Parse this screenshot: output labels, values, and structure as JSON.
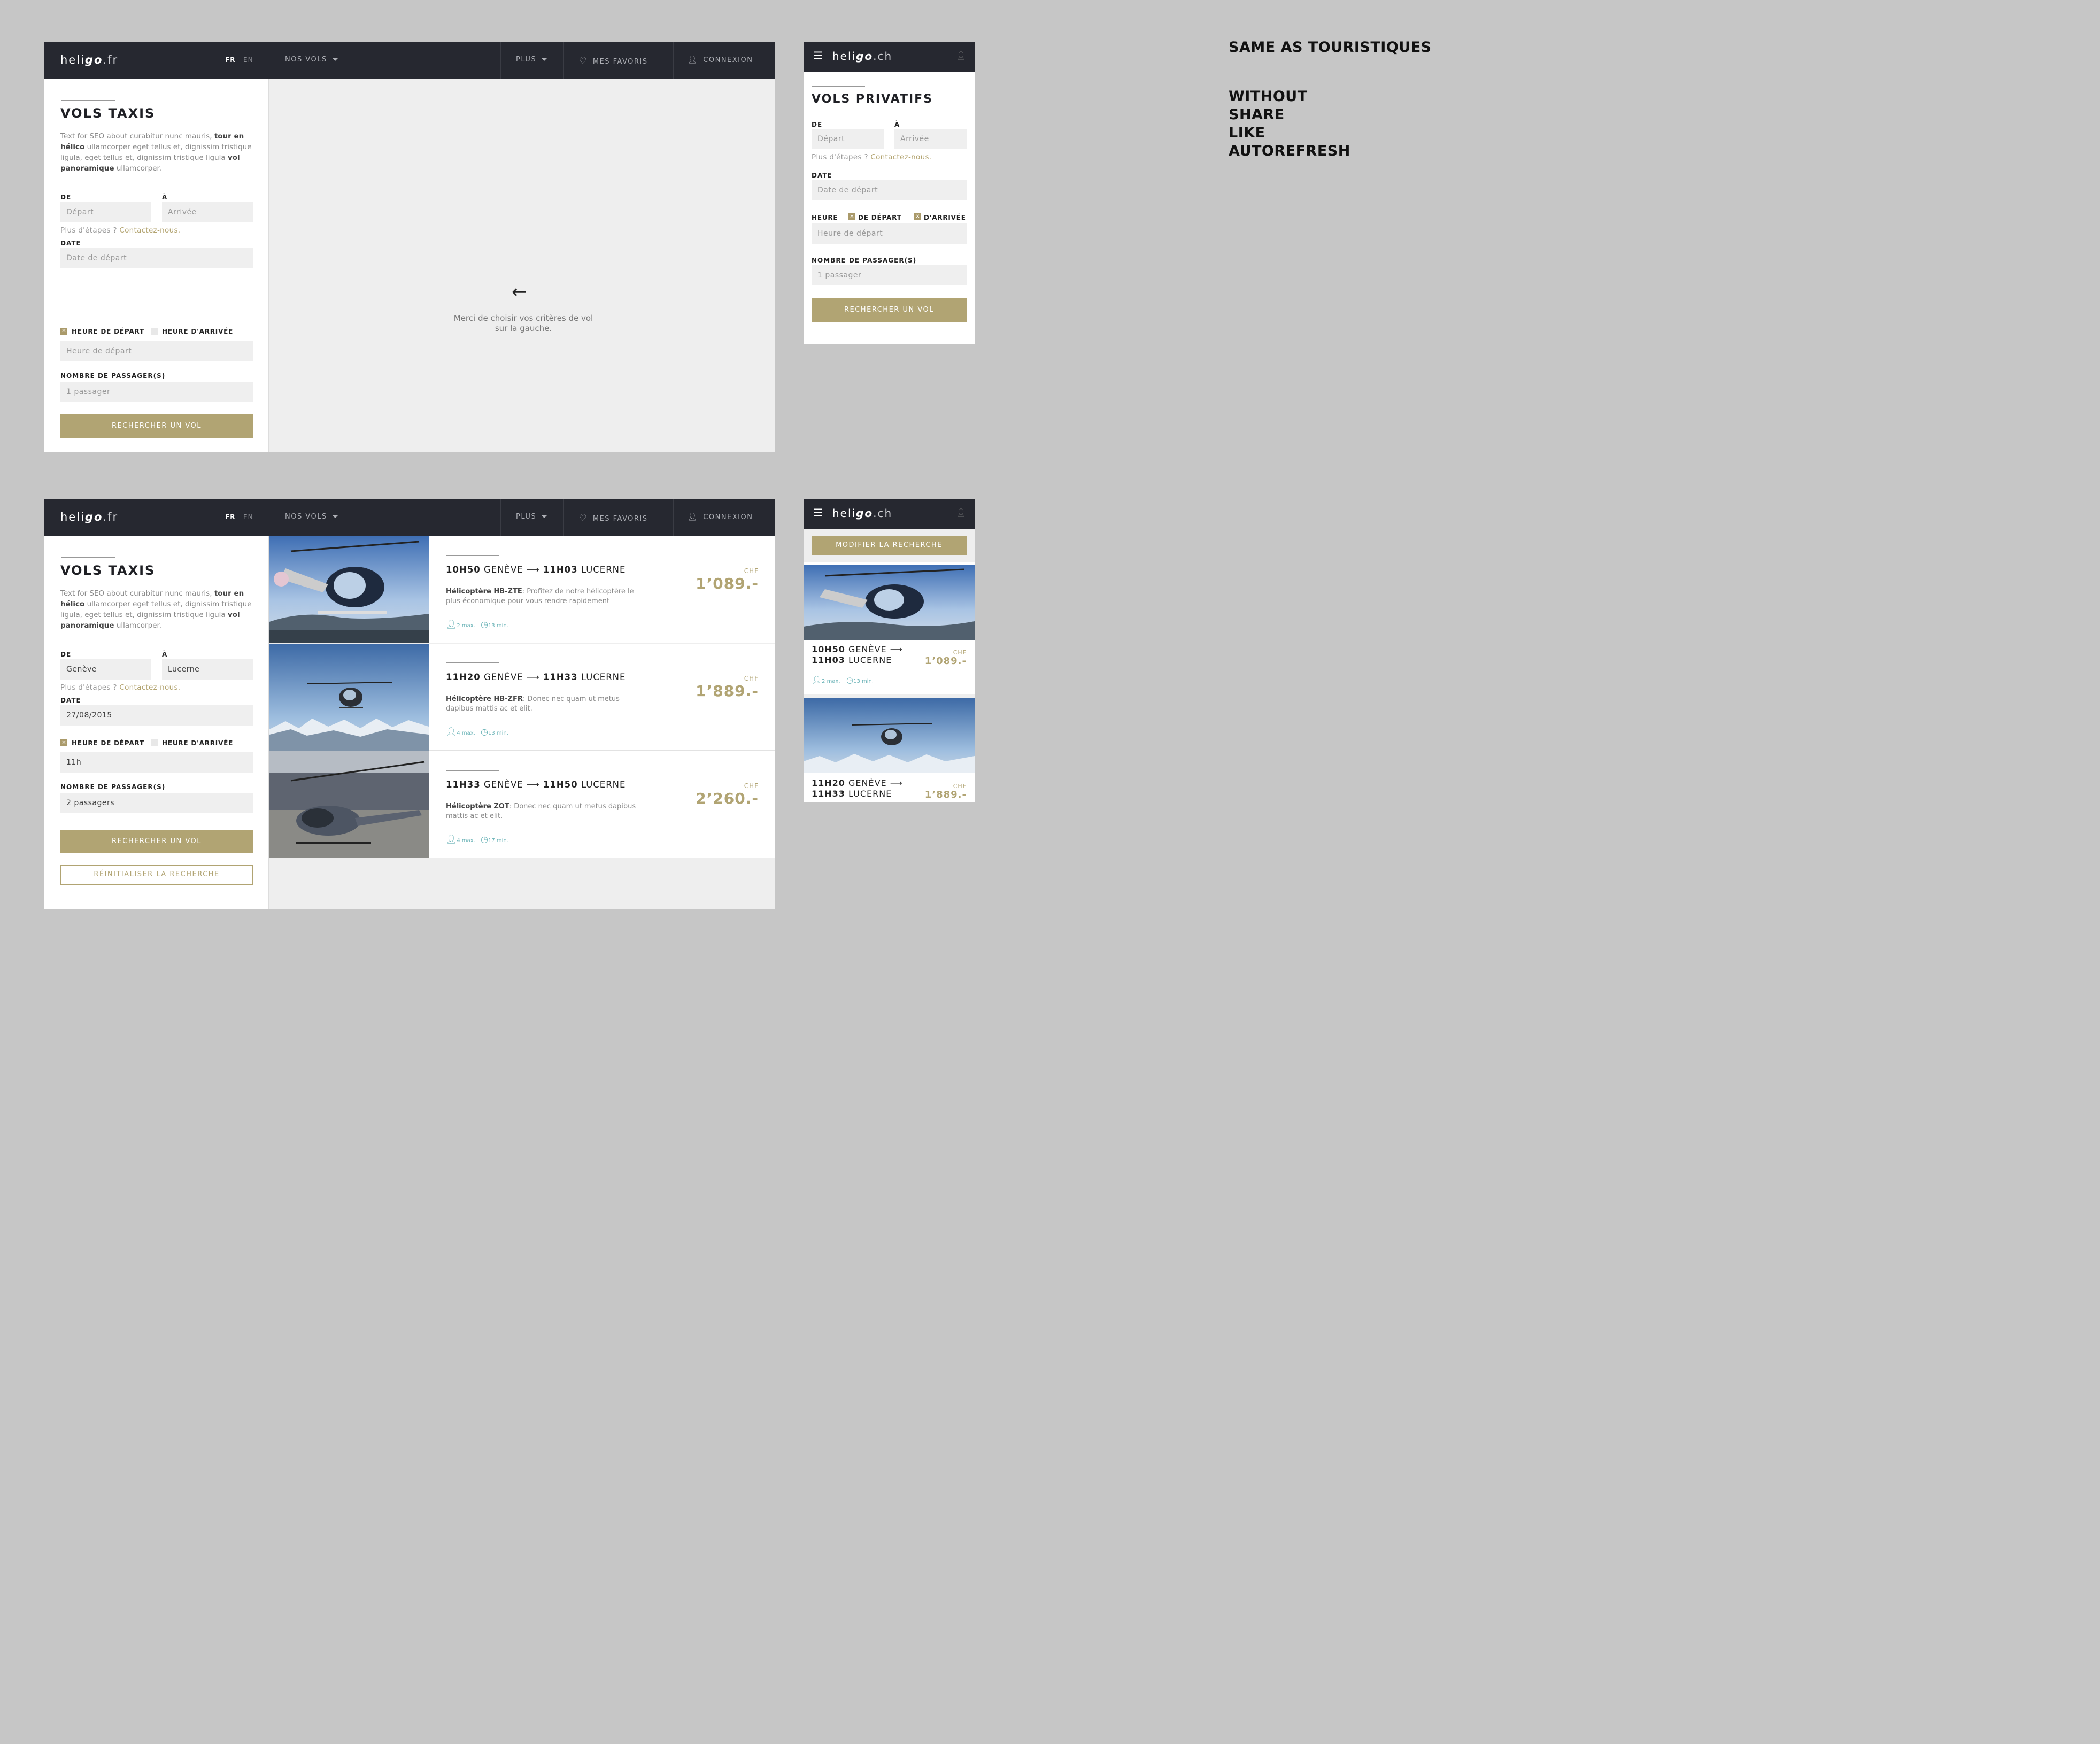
{
  "brand": {
    "name_pre": "heli",
    "name_bold": "go",
    "domain_fr": ".fr",
    "domain_ch": ".ch"
  },
  "nav": {
    "lang_fr": "FR",
    "lang_en": "EN",
    "vols": "NOS VOLS",
    "plus": "PLUS",
    "favoris": "MES FAVORIS",
    "connexion": "CONNEXION"
  },
  "form": {
    "title_taxis": "VOLS TAXIS",
    "title_privatifs": "VOLS PRIVATIFS",
    "seo_text_1": "Text for SEO about curabitur nunc mauris, ",
    "seo_bold_1": "tour en hélico",
    "seo_text_2": " ullamcorper eget tellus et, dignissim tristique ligula, eget tellus et, dignissim tristique ligula ",
    "seo_bold_2": "vol panoramique",
    "seo_text_3": " ullamcorper.",
    "de": "DE",
    "a": "À",
    "depart_ph": "Départ",
    "arrivee_ph": "Arrivée",
    "etapes": "Plus d'étapes ? ",
    "contact": "Contactez-nous.",
    "date": "DATE",
    "date_ph": "Date de départ",
    "heure": "HEURE",
    "heure_depart": "HEURE DE DÉPART",
    "heure_arrivee": "HEURE D'ARRIVÉE",
    "m_de_depart": "DE DÉPART",
    "m_d_arrivee": "D'ARRIVÉE",
    "heure_ph": "Heure de départ",
    "pax": "NOMBRE DE PASSAGER(S)",
    "pax_ph": "1 passager",
    "search": "RECHERCHER UN VOL",
    "reset": "RÉINITIALISER LA RECHERCHE",
    "modify": "MODIFIER LA RECHERCHE",
    "filled": {
      "de": "Genève",
      "a": "Lucerne",
      "date": "27/08/2015",
      "heure": "11h",
      "pax": "2 passagers"
    }
  },
  "empty_state": {
    "line1": "Merci de choisir vos critères de vol",
    "line2": "sur la gauche."
  },
  "results": [
    {
      "dep_time": "10H50",
      "dep": "GENÈVE",
      "arr_time": "11H03",
      "arr": "LUCERNE",
      "heli": "Hélicoptère HB-ZTE",
      "desc": ": Profitez de notre hélicoptère le plus économique pour vous rendre rapidement",
      "currency": "CHF",
      "price": "1’089.-",
      "pax": "2",
      "pax_unit": "max.",
      "dur": "13",
      "dur_unit": "min."
    },
    {
      "dep_time": "11H20",
      "dep": "GENÈVE",
      "arr_time": "11H33",
      "arr": "LUCERNE",
      "heli": "Hélicoptère HB-ZFR",
      "desc": ": Donec nec quam ut metus dapibus mattis ac et elit.",
      "currency": "CHF",
      "price": "1’889.-",
      "pax": "4",
      "pax_unit": "max.",
      "dur": "13",
      "dur_unit": "min."
    },
    {
      "dep_time": "11H33",
      "dep": "GENÈVE",
      "arr_time": "11H50",
      "arr": "LUCERNE",
      "heli": "Hélicoptère ZOT",
      "desc": ": Donec nec quam ut metus dapibus mattis ac et elit.",
      "currency": "CHF",
      "price": "2’260.-",
      "pax": "4",
      "pax_unit": "max.",
      "dur": "17",
      "dur_unit": "min."
    }
  ],
  "mobile_results": [
    {
      "dep_time": "10H50",
      "dep": "GENÈVE",
      "arr_time": "11H03",
      "arr": "LUCERNE",
      "currency": "CHF",
      "price": "1’089.-",
      "pax": "2",
      "pax_unit": "max.",
      "dur": "13",
      "dur_unit": "min."
    },
    {
      "dep_time": "11H20",
      "dep": "GENÈVE",
      "arr_time": "11H33",
      "arr": "LUCERNE",
      "currency": "CHF",
      "price": "1’889.-"
    }
  ],
  "notes": {
    "same": "SAME AS TOURISTIQUES",
    "without": "WITHOUT",
    "share": "SHARE",
    "like": "LIKE",
    "autorefresh": "AUTOREFRESH"
  },
  "colors": {
    "gold": "#b1a473",
    "dark": "#262830",
    "teal": "#6ab3b7"
  }
}
